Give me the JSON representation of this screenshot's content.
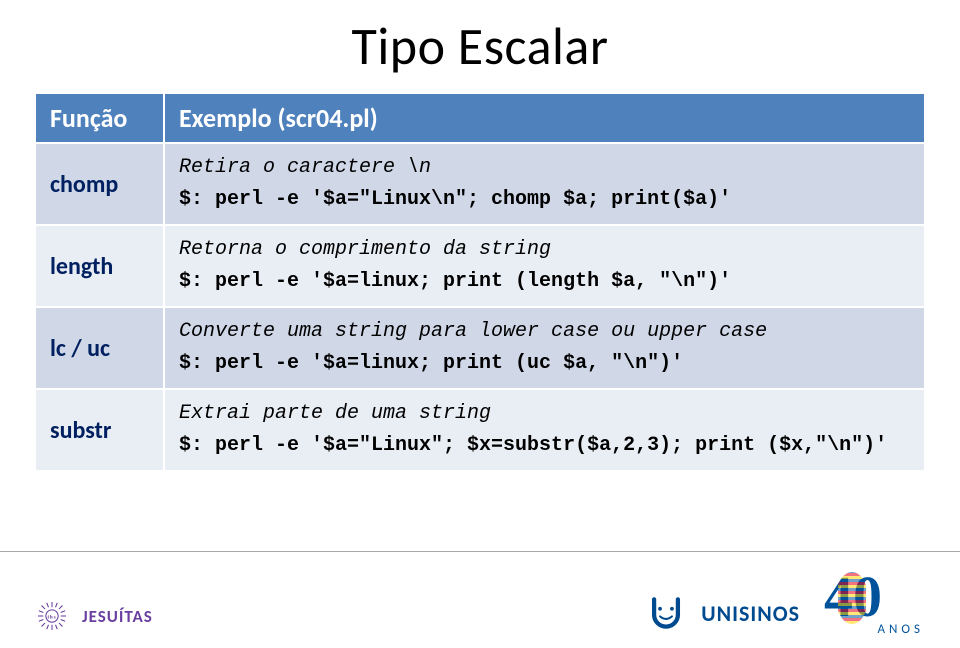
{
  "title": "Tipo Escalar",
  "table": {
    "header": {
      "col1": "Função",
      "col2": "Exemplo (scr04.pl)"
    },
    "rows": [
      {
        "func": "chomp",
        "desc": "Retira o caractere \\n",
        "code": "$: perl -e '$a=\"Linux\\n\"; chomp $a; print($a)'"
      },
      {
        "func": "length",
        "desc": "Retorna o comprimento da string",
        "code": "$: perl -e '$a=linux; print (length $a, \"\\n\")'"
      },
      {
        "func": "lc / uc",
        "desc": "Converte uma string para lower case ou upper case",
        "code": "$: perl -e '$a=linux; print (uc $a, \"\\n\")'"
      },
      {
        "func": "substr",
        "desc": "Extrai parte de uma string",
        "code": "$: perl -e '$a=\"Linux\"; $x=substr($a,2,3); print ($x,\"\\n\")'"
      }
    ]
  },
  "footer": {
    "jesuitas": "JESUÍTAS",
    "unisinos": "UNISINOS",
    "anos_num": "40",
    "anos_label": "ANOS"
  }
}
